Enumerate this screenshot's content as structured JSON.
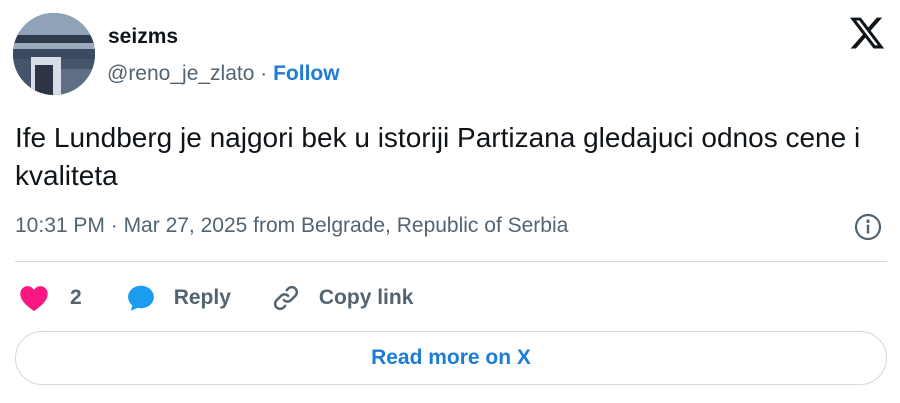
{
  "user": {
    "display_name": "seizms",
    "handle": "@reno_je_zlato",
    "separator": " · ",
    "follow_label": "Follow"
  },
  "tweet": {
    "text": "Ife Lundberg je najgori bek u istoriji Partizana gledajuci odnos cene i kvaliteta",
    "time": "10:31 PM",
    "date": "Mar 27, 2025",
    "location": "from Belgrade, Republic of Serbia"
  },
  "actions": {
    "like_count": "2",
    "reply_label": "Reply",
    "copy_link_label": "Copy link"
  },
  "footer": {
    "read_more_label": "Read more on X"
  },
  "icons": {
    "logo": "x-logo-icon",
    "info": "info-icon",
    "like": "heart-icon",
    "reply": "speech-bubble-icon",
    "copy_link": "link-icon"
  },
  "colors": {
    "accent": "#1d7cd6",
    "like": "#f91880",
    "muted_text": "#536471",
    "text": "#0f1419",
    "border": "#cfd9de"
  }
}
